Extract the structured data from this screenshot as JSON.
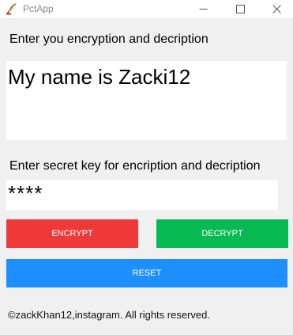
{
  "window": {
    "title": "PctApp",
    "icon": "feather-pen-icon"
  },
  "controls": {
    "minimize_icon": "minimize-icon",
    "maximize_icon": "maximize-icon",
    "close_icon": "close-icon"
  },
  "main": {
    "message_label": "Enter you encryption and decription",
    "message_value": "My name is Zacki12",
    "key_label": "Enter secret key for encription and decription",
    "key_value": "****"
  },
  "buttons": {
    "encrypt": {
      "label": "ENCRYPT",
      "color": "#ef3838"
    },
    "decrypt": {
      "label": "DECRYPT",
      "color": "#08ba52"
    },
    "reset": {
      "label": "RESET",
      "color": "#1d8fff"
    }
  },
  "footer": {
    "text": "©zackKhan12,instagram. All rights reserved."
  }
}
